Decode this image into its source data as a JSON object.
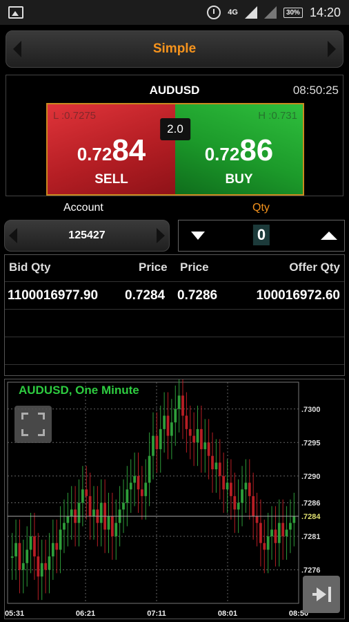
{
  "status_bar": {
    "time": "14:20",
    "battery": "30%",
    "network": "4G"
  },
  "mode": {
    "title": "Simple"
  },
  "quote": {
    "symbol": "AUDUSD",
    "time": "08:50:25",
    "low": "L :0.7275",
    "high": "H :0.731",
    "spread": "2.0",
    "sell": {
      "prefix": "0.72",
      "pips": "84",
      "label": "SELL"
    },
    "buy": {
      "prefix": "0.72",
      "pips": "86",
      "label": "BUY"
    }
  },
  "account": {
    "label": "Account",
    "value": "125427"
  },
  "qty": {
    "label": "Qty",
    "value": "0"
  },
  "depth": {
    "headers": {
      "bid_qty": "Bid Qty",
      "bid_price": "Price",
      "offer_price": "Price",
      "offer_qty": "Offer Qty"
    },
    "rows": [
      {
        "bid_qty": "1100016977.90",
        "bid_price": "0.7284",
        "offer_price": "0.7286",
        "offer_qty": "100016972.60"
      }
    ]
  },
  "chart": {
    "title": "AUDUSD, One Minute",
    "current_price_label": ".7284"
  },
  "chart_data": {
    "type": "candlestick",
    "title": "AUDUSD, One Minute",
    "x_ticks": [
      "05:31",
      "06:21",
      "07:11",
      "08:01",
      "08:50"
    ],
    "y_ticks": [
      ".7300",
      ".7295",
      ".7290",
      ".7286",
      ".7281",
      ".7276"
    ],
    "y_tick_values": [
      0.73,
      0.7295,
      0.729,
      0.7286,
      0.7281,
      0.7276
    ],
    "ylim": [
      0.7271,
      0.7304
    ],
    "current_price": 0.7284,
    "grid": true,
    "colors": {
      "up": "#2e9e3a",
      "down": "#b81e24",
      "title": "#2ecc40",
      "current": "#e0e070"
    },
    "closes": [
      0.7278,
      0.728,
      0.7276,
      0.7277,
      0.7279,
      0.7281,
      0.7278,
      0.7275,
      0.7277,
      0.7276,
      0.7278,
      0.728,
      0.7279,
      0.7282,
      0.7283,
      0.7284,
      0.7285,
      0.7283,
      0.7286,
      0.7288,
      0.7287,
      0.7284,
      0.7285,
      0.7283,
      0.7286,
      0.7282,
      0.7284,
      0.7281,
      0.7283,
      0.7285,
      0.7286,
      0.7288,
      0.7289,
      0.729,
      0.7288,
      0.7287,
      0.7289,
      0.7293,
      0.7296,
      0.7294,
      0.7297,
      0.7299,
      0.7296,
      0.7298,
      0.73,
      0.7302,
      0.7299,
      0.7297,
      0.7296,
      0.7295,
      0.7297,
      0.7294,
      0.7295,
      0.7293,
      0.7291,
      0.7292,
      0.729,
      0.7288,
      0.7289,
      0.7287,
      0.7285,
      0.7286,
      0.7288,
      0.7289,
      0.7287,
      0.7284,
      0.7283,
      0.728,
      0.7279,
      0.7281,
      0.7282,
      0.728,
      0.7283,
      0.7281,
      0.7282,
      0.7283,
      0.7284
    ]
  },
  "icons": {
    "expand": "expand-icon",
    "skip_end": "skip-to-end-icon"
  }
}
